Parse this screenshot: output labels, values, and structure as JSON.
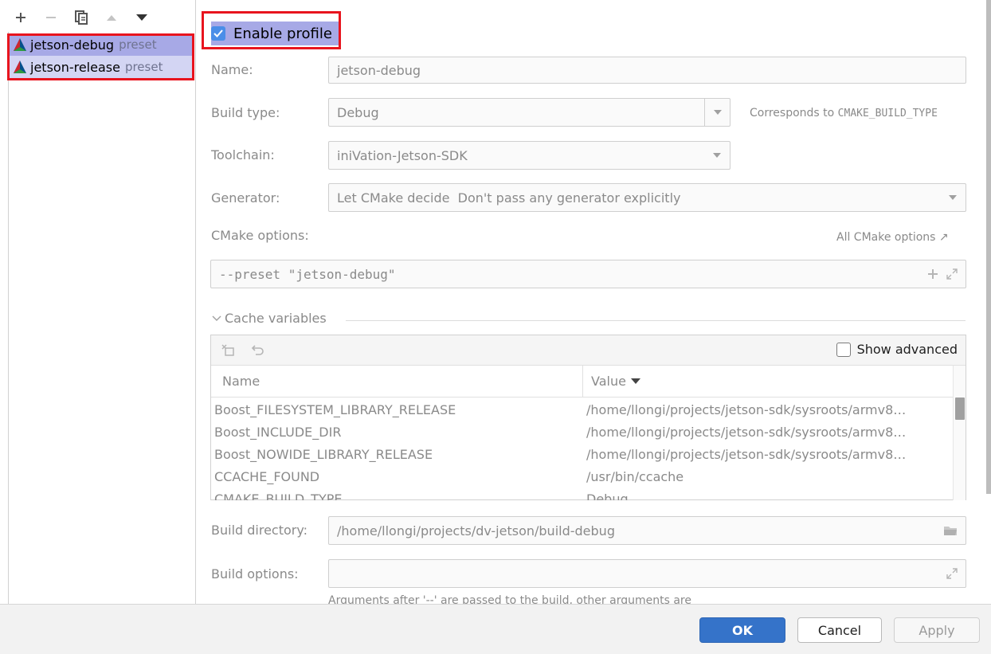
{
  "left_toolbar": {
    "buttons": [
      {
        "icon": "plus-icon",
        "glyph": "+"
      },
      {
        "icon": "minus-icon",
        "glyph": "−"
      },
      {
        "icon": "copy-icon"
      },
      {
        "icon": "move-up-icon"
      },
      {
        "icon": "move-down-icon"
      }
    ]
  },
  "profiles": [
    {
      "name": "jetson-debug",
      "tag": "preset",
      "selected": true
    },
    {
      "name": "jetson-release",
      "tag": "preset",
      "selected": true
    }
  ],
  "enable_profile": {
    "label": "Enable profile",
    "checked": true
  },
  "form": {
    "name_label": "Name:",
    "name_value": "jetson-debug",
    "build_type_label": "Build type:",
    "build_type_value": "Debug",
    "build_type_hint_prefix": "Corresponds to ",
    "build_type_hint_code": "CMAKE_BUILD_TYPE",
    "toolchain_label": "Toolchain:",
    "toolchain_value": "iniVation-Jetson-SDK",
    "generator_label": "Generator:",
    "generator_value": "Let CMake decide  Don't pass any generator explicitly",
    "cmake_options_label": "CMake options:",
    "all_cmake_options_link": "All CMake options ↗",
    "cmake_options_value": "--preset \"jetson-debug\""
  },
  "cache": {
    "section_title": "Cache variables",
    "show_advanced_label": "Show advanced",
    "show_advanced_checked": false,
    "col_name": "Name",
    "col_value": "Value",
    "rows": [
      {
        "name": "Boost_FILESYSTEM_LIBRARY_RELEASE",
        "value": "/home/llongi/projects/jetson-sdk/sysroots/armv8…"
      },
      {
        "name": "Boost_INCLUDE_DIR",
        "value": "/home/llongi/projects/jetson-sdk/sysroots/armv8…"
      },
      {
        "name": "Boost_NOWIDE_LIBRARY_RELEASE",
        "value": "/home/llongi/projects/jetson-sdk/sysroots/armv8…"
      },
      {
        "name": "CCACHE_FOUND",
        "value": "/usr/bin/ccache"
      },
      {
        "name": "CMAKE_BUILD_TYPE",
        "value": "Debug"
      }
    ]
  },
  "build": {
    "directory_label": "Build directory:",
    "directory_value": "/home/llongi/projects/dv-jetson/build-debug",
    "options_label": "Build options:",
    "options_value": "",
    "options_hint": "Arguments after '--' are passed to the build, other arguments are"
  },
  "footer": {
    "ok": "OK",
    "cancel": "Cancel",
    "apply": "Apply"
  },
  "colors": {
    "selection": "#a7a9e6",
    "highlight_box": "#e8141e",
    "ok_button": "#3573c9",
    "checkbox": "#4a8ee8"
  }
}
